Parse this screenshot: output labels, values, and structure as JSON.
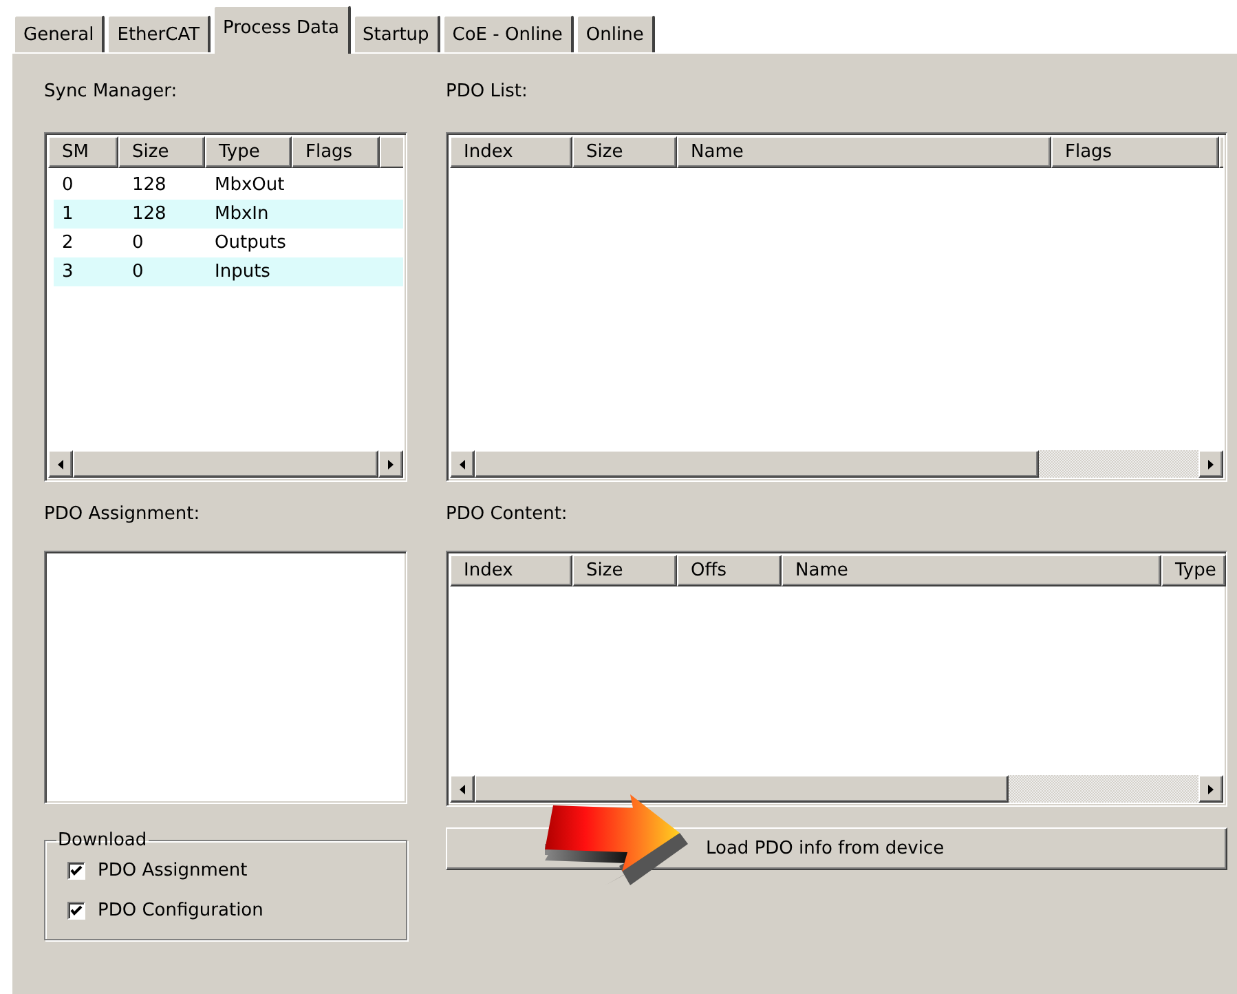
{
  "tabs": [
    {
      "label": "General",
      "selected": false
    },
    {
      "label": "EtherCAT",
      "selected": false
    },
    {
      "label": "Process Data",
      "selected": true
    },
    {
      "label": "Startup",
      "selected": false
    },
    {
      "label": "CoE - Online",
      "selected": false
    },
    {
      "label": "Online",
      "selected": false
    }
  ],
  "sync_manager": {
    "label": "Sync Manager:",
    "columns": [
      "SM",
      "Size",
      "Type",
      "Flags"
    ],
    "rows": [
      {
        "sm": "0",
        "size": "128",
        "type": "MbxOut"
      },
      {
        "sm": "1",
        "size": "128",
        "type": "MbxIn"
      },
      {
        "sm": "2",
        "size": "0",
        "type": "Outputs"
      },
      {
        "sm": "3",
        "size": "0",
        "type": "Inputs"
      }
    ]
  },
  "pdo_list": {
    "label": "PDO List:",
    "columns": [
      "Index",
      "Size",
      "Name",
      "Flags"
    ]
  },
  "pdo_assignment": {
    "label": "PDO Assignment:"
  },
  "pdo_content": {
    "label": "PDO Content:",
    "columns": [
      "Index",
      "Size",
      "Offs",
      "Name",
      "Type"
    ]
  },
  "load_button": {
    "label": "Load PDO info from device"
  },
  "download": {
    "legend": "Download",
    "options": [
      {
        "label": "PDO Assignment",
        "checked": true
      },
      {
        "label": "PDO Configuration",
        "checked": true
      }
    ]
  }
}
